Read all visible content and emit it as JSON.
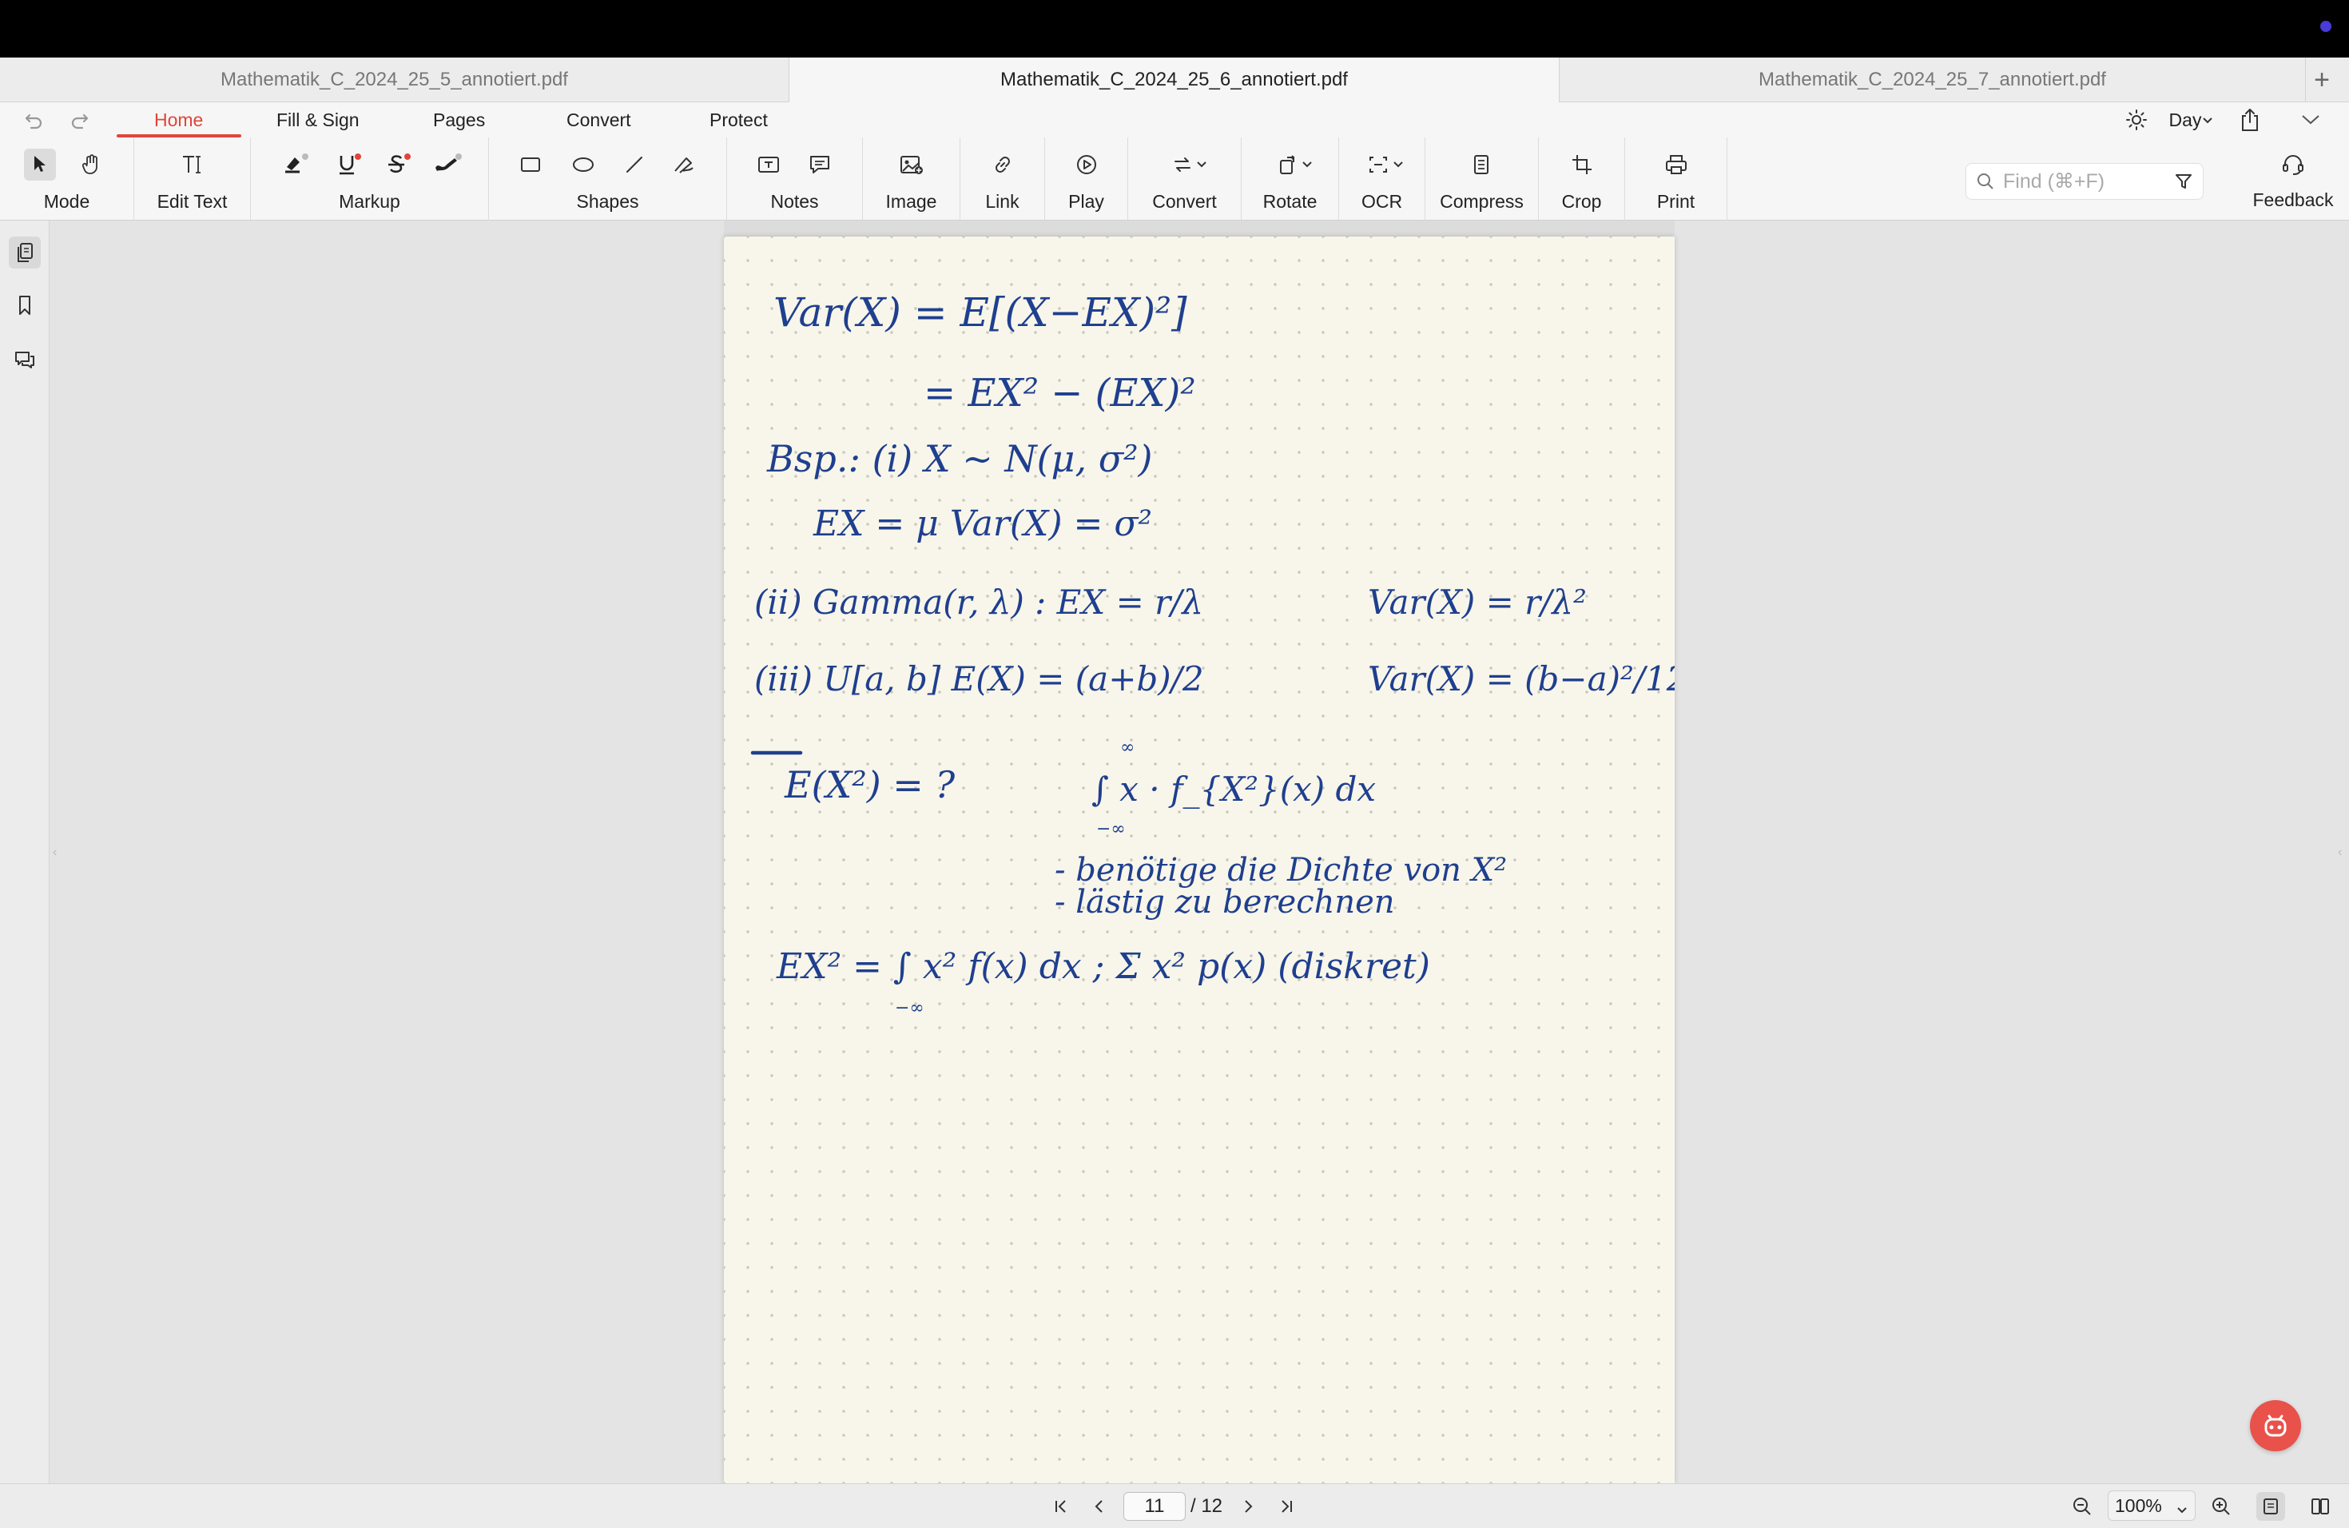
{
  "tabs": [
    {
      "label": "Mathematik_C_2024_25_5_annotiert.pdf"
    },
    {
      "label": "Mathematik_C_2024_25_6_annotiert.pdf"
    },
    {
      "label": "Mathematik_C_2024_25_7_annotiert.pdf"
    }
  ],
  "menu": {
    "items": [
      "Home",
      "Fill & Sign",
      "Pages",
      "Convert",
      "Protect"
    ],
    "theme_label": "Day"
  },
  "toolbar": {
    "mode": "Mode",
    "edit_text": "Edit Text",
    "markup": "Markup",
    "shapes": "Shapes",
    "notes": "Notes",
    "image": "Image",
    "link": "Link",
    "play": "Play",
    "convert": "Convert",
    "rotate": "Rotate",
    "ocr": "OCR",
    "compress": "Compress",
    "crop": "Crop",
    "print": "Print",
    "feedback": "Feedback",
    "find_placeholder": "Find (⌘+F)"
  },
  "notes_content": {
    "line1": "Var(X) = E[(X−EX)²]",
    "line2": "= EX² − (EX)²",
    "line3": "Bsp.: (i) X ~ N(μ, σ²)",
    "line4": "EX = μ     Var(X) = σ²",
    "line5_a": "(ii) Gamma(r, λ) :   EX = r/λ",
    "line5_b": "Var(X) = r/λ²",
    "line6_a": "(iii) U[a, b]        E(X) = (a+b)/2",
    "line6_b": "Var(X) = (b−a)²/12",
    "line7_a": "E(X²) = ?",
    "line7_b": "∫ x · f_{X²}(x) dx",
    "line8": "- benötige die Dichte von  X²",
    "line9": "- lästig zu berechnen",
    "line10": "EX² = ∫ x² f(x) dx   ;   Σ x² p(x)  (diskret)"
  },
  "pagination": {
    "current": "11",
    "total": "/ 12"
  },
  "zoom": {
    "value": "100%"
  },
  "colors": {
    "accent": "#e0453a",
    "ink": "#1f3f8f",
    "paper": "#f8f6ea"
  }
}
